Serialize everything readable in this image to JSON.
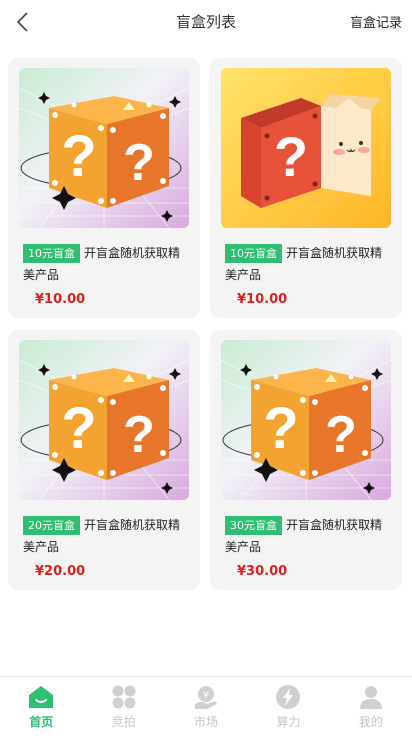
{
  "header": {
    "title": "盲盒列表",
    "records_label": "盲盒记录"
  },
  "products": [
    {
      "tag": "10元盲盒",
      "name": "开盲盒随机获取精美产品",
      "price": "¥10.00",
      "image": "question-box"
    },
    {
      "tag": "10元盲盒",
      "name": "开盲盒随机获取精美产品",
      "price": "¥10.00",
      "image": "cat-box"
    },
    {
      "tag": "20元盲盒",
      "name": "开盲盒随机获取精美产品",
      "price": "¥20.00",
      "image": "question-box"
    },
    {
      "tag": "30元盲盒",
      "name": "开盲盒随机获取精美产品",
      "price": "¥30.00",
      "image": "question-box"
    }
  ],
  "tabbar": [
    {
      "label": "首页",
      "icon": "home-icon",
      "active": true
    },
    {
      "label": "竞拍",
      "icon": "grid-icon",
      "active": false
    },
    {
      "label": "市场",
      "icon": "market-icon",
      "active": false
    },
    {
      "label": "算力",
      "icon": "lightning-icon",
      "active": false
    },
    {
      "label": "我的",
      "icon": "user-icon",
      "active": false
    }
  ],
  "colors": {
    "accent": "#2fbf72",
    "price": "#e02020",
    "inactive": "#c6c6c6"
  }
}
